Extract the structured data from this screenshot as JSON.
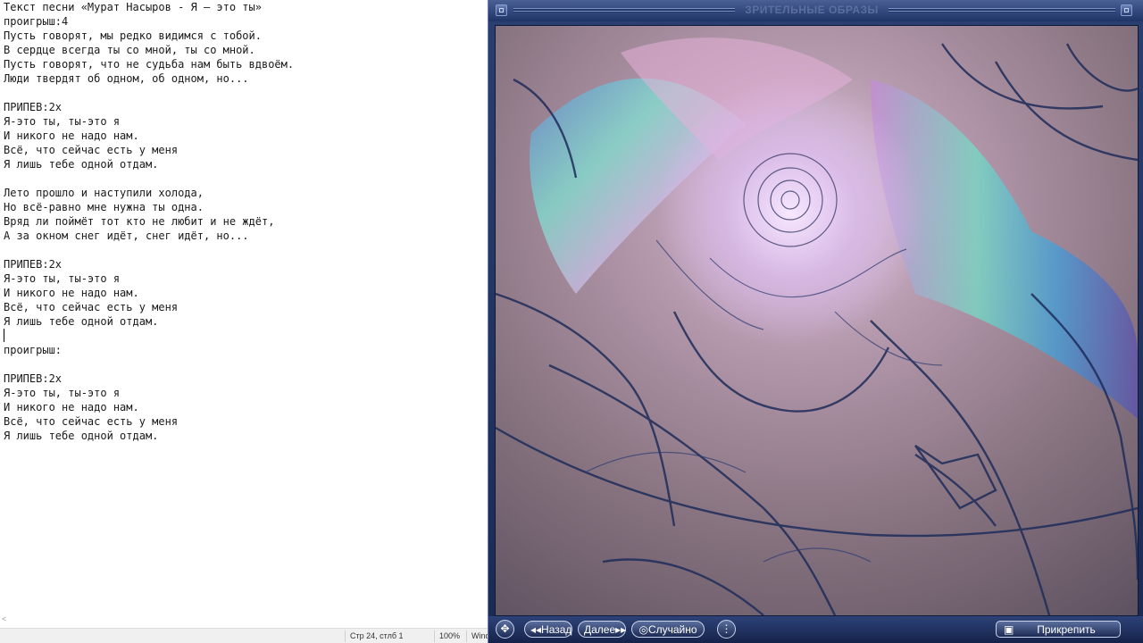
{
  "notepad": {
    "lines": [
      "Текст песни «Мурат Насыров - Я — это ты»",
      "проигрыш:4",
      "Пусть говорят, мы редко видимся с тобой.",
      "В сердце всегда ты со мной, ты со мной.",
      "Пусть говорят, что не судьба нам быть вдвоём.",
      "Люди твердят об одном, об одном, но...",
      "",
      "ПРИПЕВ:2х",
      "Я-это ты, ты-это я",
      "И никого не надо нам.",
      "Всё, что сейчас есть у меня",
      "Я лишь тебе одной отдам.",
      "",
      "Лето прошло и наступили холода,",
      "Но всё-равно мне нужна ты одна.",
      "Вряд ли поймёт тот кто не любит и не ждёт,",
      "А за окном снег идёт, снег идёт, но...",
      "",
      "ПРИПЕВ:2х",
      "Я-это ты, ты-это я",
      "И никого не надо нам.",
      "Всё, что сейчас есть у меня",
      "Я лишь тебе одной отдам.",
      "",
      "проигрыш:",
      "",
      "ПРИПЕВ:2х",
      "Я-это ты, ты-это я",
      "И никого не надо нам.",
      "Всё, что сейчас есть у меня",
      "Я лишь тебе одной отдам."
    ],
    "status": {
      "position": "Стр 24, стлб 1",
      "zoom": "100%",
      "encoding": "Wind"
    }
  },
  "visualizer": {
    "title": "ЗРИТЕЛЬНЫЕ ОБРАЗЫ",
    "controls": {
      "back": "Назад",
      "next": "Далее",
      "random": "Случайно",
      "attach": "Прикрепить"
    }
  },
  "icons": {
    "move": "move-arrows-icon",
    "settings": "settings-icon",
    "attach": "attach-icon",
    "random": "random-icon"
  }
}
